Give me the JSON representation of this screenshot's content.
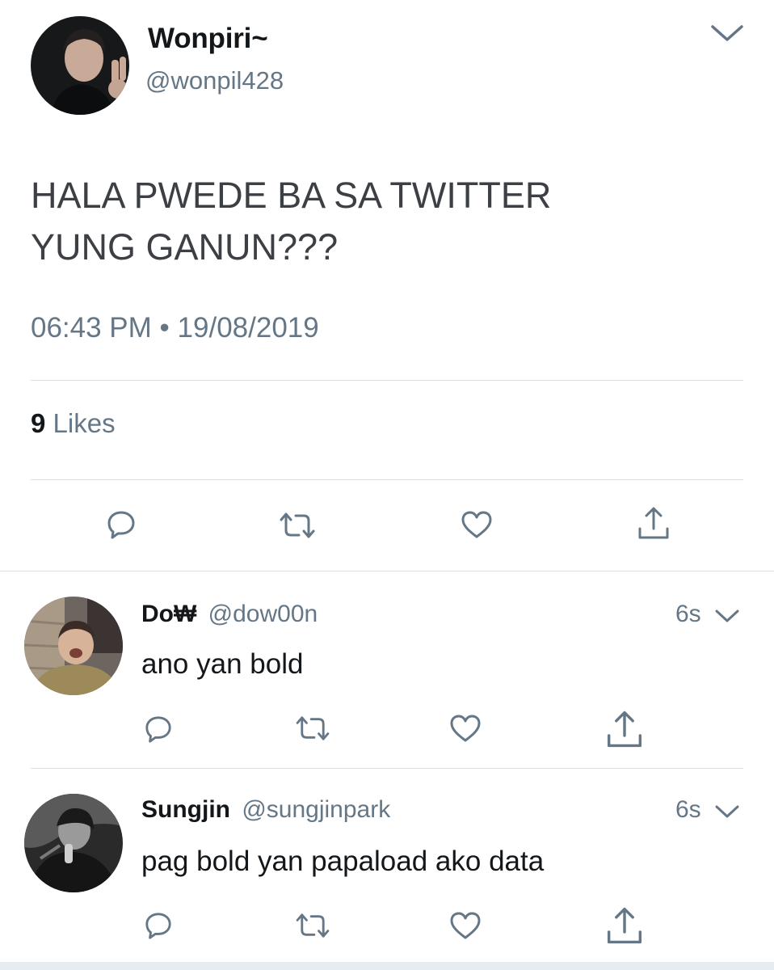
{
  "tweet": {
    "author_name": "Wonpiri~",
    "author_handle": "@wonpil428",
    "text_line1": "HALA PWEDE BA SA TWITTER",
    "text_line2": "YUNG GANUN???",
    "time": "06:43 PM",
    "separator": "•",
    "date": "19/08/2019",
    "likes_count": "9",
    "likes_label": "Likes"
  },
  "replies": [
    {
      "name": "Do₩",
      "handle": "@dow00n",
      "time": "6s",
      "text": "ano yan bold"
    },
    {
      "name": "Sungjin",
      "handle": "@sungjinpark",
      "time": "6s",
      "text": "pag bold yan papaload ako data"
    }
  ],
  "icons": [
    "chevron-down-icon",
    "reply-icon",
    "retweet-icon",
    "like-icon",
    "share-icon"
  ],
  "colors": {
    "text_primary": "#14171a",
    "text_secondary": "#657786",
    "divider": "#dbe0e4",
    "background": "#ffffff"
  }
}
